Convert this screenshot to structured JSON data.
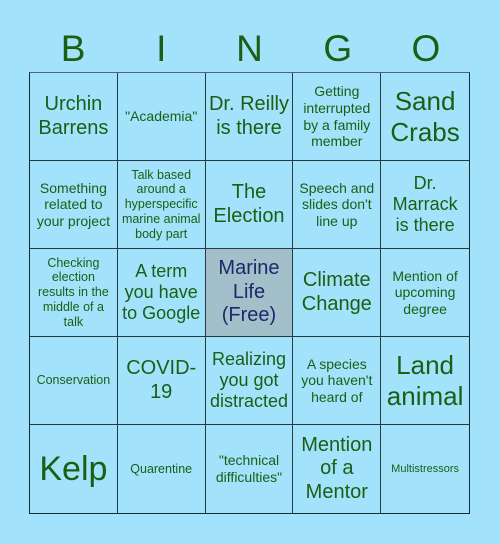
{
  "header": {
    "letters": [
      "B",
      "I",
      "N",
      "G",
      "O"
    ]
  },
  "colors": {
    "background": "#a2e3fb",
    "text": "#1b5e14",
    "free_background": "#a3bfc9",
    "free_text": "#1b2a6a"
  },
  "cells": [
    {
      "text": "Urchin Barrens",
      "free": false
    },
    {
      "text": "\"Academia\"",
      "free": false
    },
    {
      "text": "Dr. Reilly is there",
      "free": false
    },
    {
      "text": "Getting interrupted by a family member",
      "free": false
    },
    {
      "text": "Sand Crabs",
      "free": false
    },
    {
      "text": "Something related to your project",
      "free": false
    },
    {
      "text": "Talk based around a hyperspecific marine animal body part",
      "free": false
    },
    {
      "text": "The Election",
      "free": false
    },
    {
      "text": "Speech and slides don't line up",
      "free": false
    },
    {
      "text": "Dr. Marrack is there",
      "free": false
    },
    {
      "text": "Checking election results in the middle of a talk",
      "free": false
    },
    {
      "text": "A term you have to Google",
      "free": false
    },
    {
      "text": "Marine Life (Free)",
      "free": true
    },
    {
      "text": "Climate Change",
      "free": false
    },
    {
      "text": "Mention of upcoming degree",
      "free": false
    },
    {
      "text": "Conservation",
      "free": false
    },
    {
      "text": "COVID-19",
      "free": false
    },
    {
      "text": "Realizing you got distracted",
      "free": false
    },
    {
      "text": "A species you haven't heard of",
      "free": false
    },
    {
      "text": "Land animal",
      "free": false
    },
    {
      "text": "Kelp",
      "free": false
    },
    {
      "text": "Quarentine",
      "free": false
    },
    {
      "text": "\"technical difficulties\"",
      "free": false
    },
    {
      "text": "Mention of a Mentor",
      "free": false
    },
    {
      "text": "Multistressors",
      "free": false
    }
  ]
}
